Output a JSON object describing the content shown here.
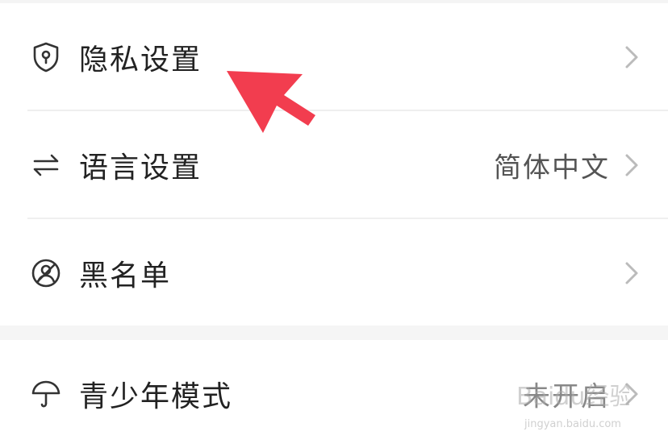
{
  "settings": {
    "items": [
      {
        "label": "隐私设置",
        "icon": "shield-lock-icon",
        "value": ""
      },
      {
        "label": "语言设置",
        "icon": "swap-arrows-icon",
        "value": "简体中文"
      },
      {
        "label": "黑名单",
        "icon": "block-user-icon",
        "value": ""
      }
    ],
    "section2": [
      {
        "label": "青少年模式",
        "icon": "umbrella-icon",
        "value": "未开启"
      }
    ]
  },
  "annotation": {
    "arrow_color": "#f23d4f",
    "icon_color": "#333333",
    "chevron_color": "#bbbbbb"
  },
  "watermark": {
    "brand": "Baidu经验",
    "url": "jingyan.baidu.com"
  }
}
